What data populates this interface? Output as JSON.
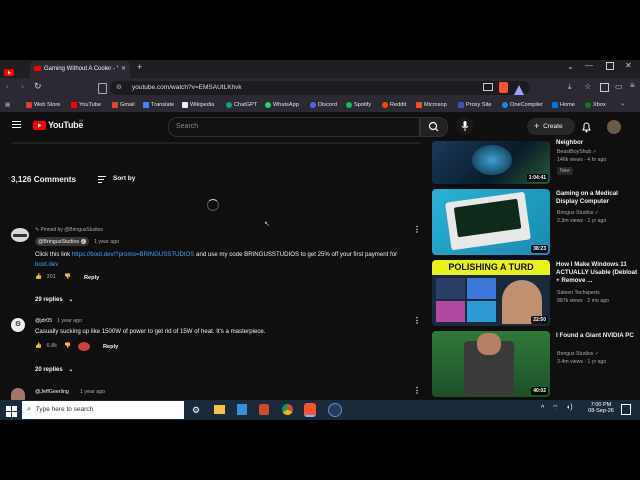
{
  "browser": {
    "tab_title": "Gaming Without A Cooler - YouTub",
    "url": "youtube.com/watch?v=EMSAUtLKhvk",
    "bookmarks": [
      "Web Store",
      "YouTube",
      "Gmail",
      "Translate",
      "Wikipedia",
      "ChatGPT",
      "WhatsApp",
      "Discord",
      "Spotify",
      "Reddit",
      "Microsop",
      "Proxy Site",
      "OneCompiler",
      "Home",
      "Xbox"
    ]
  },
  "youtube": {
    "logo_text": "YouTube",
    "region": "IN",
    "search_placeholder": "Search",
    "create_label": "Create"
  },
  "comments": {
    "count_label": "3,126 Comments",
    "sort_label": "Sort by",
    "items": [
      {
        "pinned_label": "Pinned by @BringusStudios",
        "author": "@BringusStudios",
        "time": "1 year ago",
        "text_prefix": "Click this link ",
        "link": "https://boot.dev/?promo=BRINGUSSTUDIOS",
        "text_mid": " and use my code BRINGUSSTUDIOS to get 25% off your first payment for ",
        "link2": "boot.dev",
        "likes": "301",
        "reply": "Reply",
        "replies": "29 replies"
      },
      {
        "author": "@jdr05",
        "time": "1 year ago",
        "text": "Casually sucking up like 1500W of power to get rid of 15W of heat. It's a masterpiece.",
        "likes": "6.8k",
        "reply": "Reply",
        "replies": "20 replies"
      },
      {
        "author": "@JeffGeerling",
        "time": "1 year ago"
      }
    ]
  },
  "sidebar": [
    {
      "title": "Neighbor",
      "channel": "BeastBoyShub",
      "meta": "146k views · 4 hr ago",
      "badge": "New",
      "duration": "1:04:41"
    },
    {
      "title": "Gaming on a Medical Display Computer",
      "channel": "Bringus Studios",
      "meta": "2.3m views · 1 yr ago",
      "duration": "38:23"
    },
    {
      "title": "How I Make Windows 11 ACTUALLY Usable (Debloat + Remove ...",
      "channel": "Saleen Techsperts",
      "meta": "987k views · 2 mo ago",
      "duration": "22:50",
      "thumb_text": "POLISHING A TURD"
    },
    {
      "title": "I Found a Giant NVIDIA PC",
      "channel": "Bringus Studios",
      "meta": "3.4m views · 1 yr ago",
      "duration": "40:02"
    }
  ],
  "taskbar": {
    "search_placeholder": "Type here to search",
    "time": "7:00 PM",
    "date": "08-Sep-26"
  }
}
